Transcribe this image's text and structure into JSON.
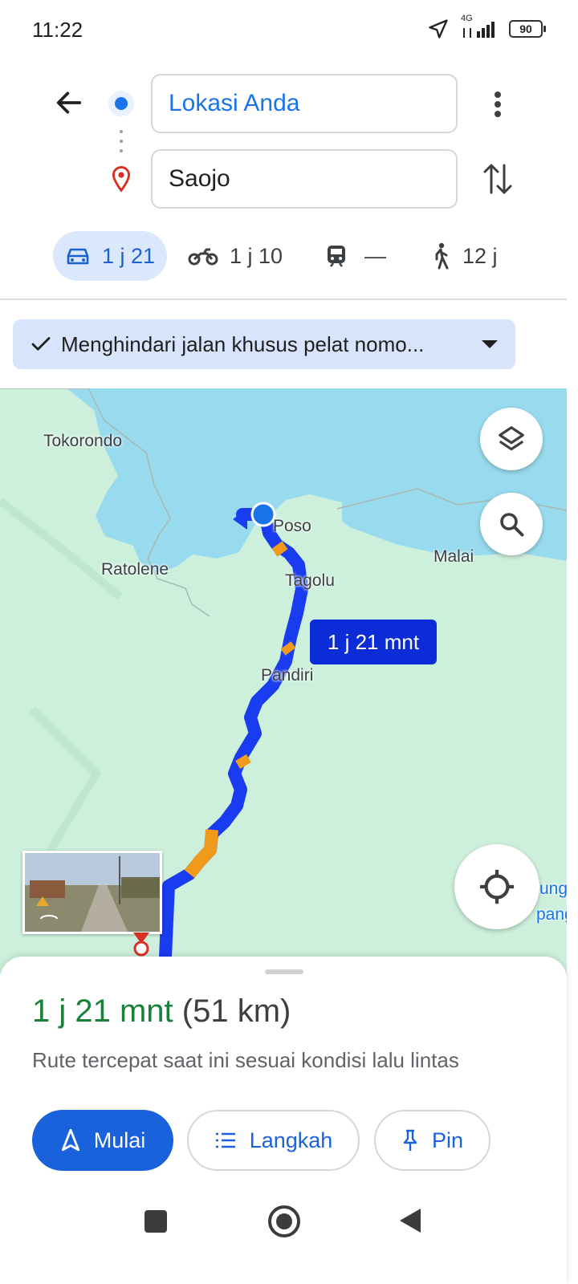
{
  "status_bar": {
    "time": "11:22",
    "network": "4G",
    "battery": "90"
  },
  "directions": {
    "origin": "Lokasi Anda",
    "destination": "Saojo"
  },
  "modes": [
    {
      "name": "car",
      "label": "1 j 21"
    },
    {
      "name": "motorcycle",
      "label": "1 j 10"
    },
    {
      "name": "transit",
      "label": "—"
    },
    {
      "name": "walk",
      "label": "12 j"
    }
  ],
  "filter": {
    "label": "Menghindari jalan khusus pelat nomo..."
  },
  "map": {
    "places": [
      "Tokorondo",
      "Poso",
      "Malai",
      "Ratolene",
      "Tagolu",
      "Pandiri",
      "ung",
      "pang"
    ],
    "eta_bubble": "1 j 21 mnt",
    "colors": {
      "water": "#98dbee",
      "land": "#cdf0dc",
      "route": "#1a3cf0",
      "traffic": "#f09a1c"
    }
  },
  "summary": {
    "duration": "1 j 21 mnt",
    "distance": "(51 km)",
    "description": "Rute tercepat saat ini sesuai kondisi lalu lintas"
  },
  "actions": {
    "start": "Mulai",
    "steps": "Langkah",
    "pin": "Pin"
  },
  "colors": {
    "accent": "#1a62dc",
    "duration_green": "#188038"
  }
}
